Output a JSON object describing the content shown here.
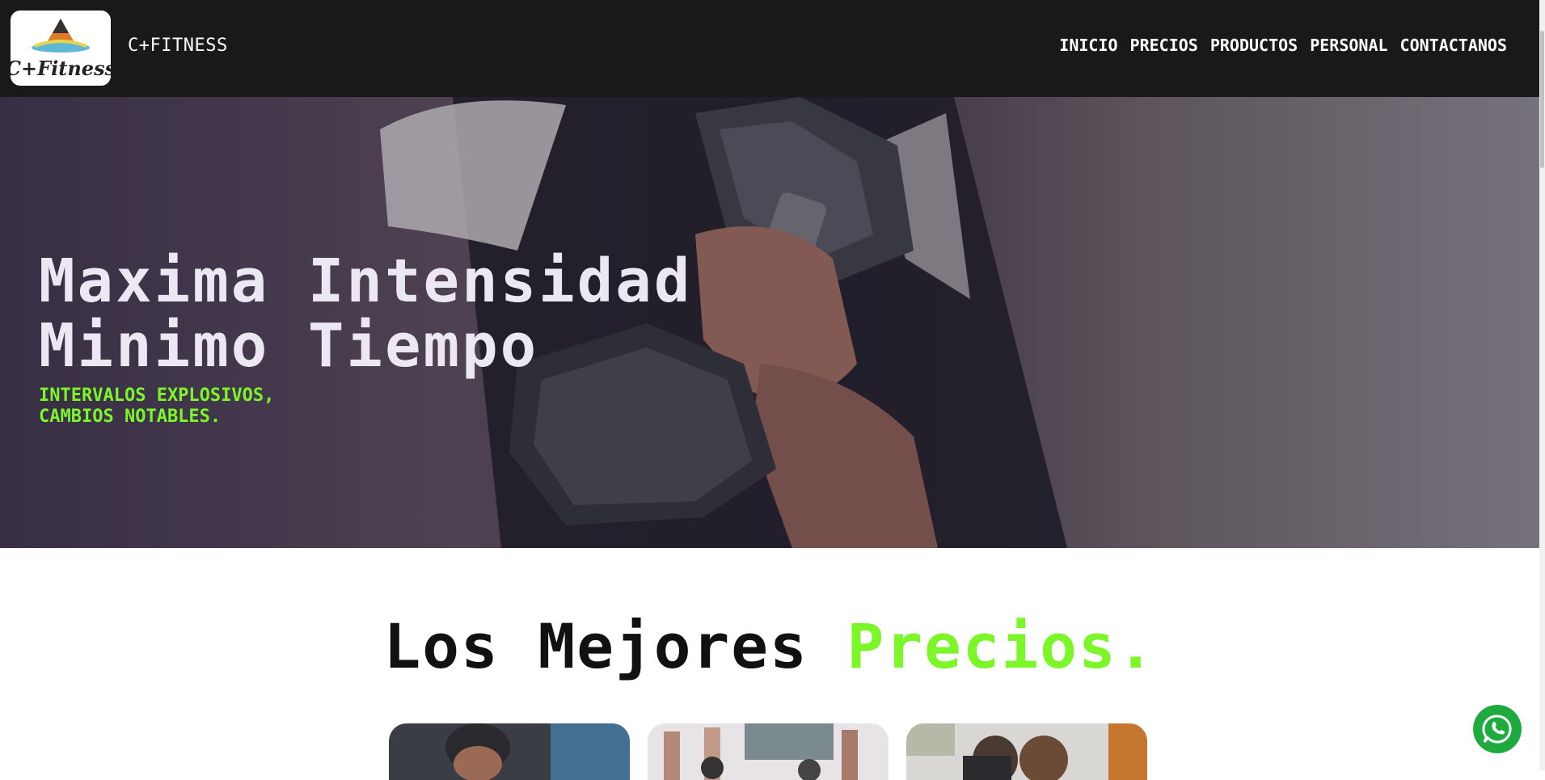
{
  "header": {
    "brand": "C+FITNESS",
    "logo_text": "C+Fitness",
    "nav": [
      "INICIO",
      "PRECIOS",
      "PRODUCTOS",
      "PERSONAL",
      "CONTACTANOS"
    ]
  },
  "hero": {
    "title_line1": "Maxima Intensidad",
    "title_line2": "Minimo Tiempo",
    "subtitle_line1": "INTERVALOS EXPLOSIVOS,",
    "subtitle_line2": "CAMBIOS NOTABLES."
  },
  "prices": {
    "title_main": "Los Mejores ",
    "title_accent": "Precios."
  },
  "colors": {
    "accent": "#7cf529",
    "header_bg": "#191919",
    "whatsapp": "#1faa3f"
  },
  "icons": {
    "whatsapp": "whatsapp-icon",
    "logo": "cfitness-logo"
  }
}
